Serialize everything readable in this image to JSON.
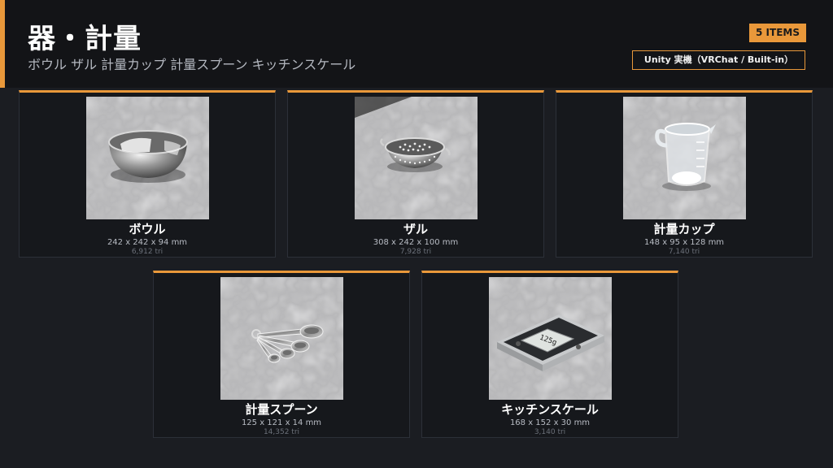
{
  "header": {
    "title": "器・計量",
    "subtitle": "ボウル ザル 計量カップ 計量スプーン キッチンスケール",
    "count_badge": "5 ITEMS",
    "env_badge": "Unity 実機（VRChat / Built-in）"
  },
  "colors": {
    "accent": "#e9983a",
    "background": "#1b1d22",
    "card_background": "#16181c"
  },
  "items": [
    {
      "name": "ボウル",
      "dims": "242 x 242 x 94 mm",
      "tris": "6,912 tri",
      "icon": "bowl-icon"
    },
    {
      "name": "ザル",
      "dims": "308 x 242 x 100 mm",
      "tris": "7,928 tri",
      "icon": "colander-icon"
    },
    {
      "name": "計量カップ",
      "dims": "148 x 95 x 128 mm",
      "tris": "7,140 tri",
      "icon": "measuring-cup-icon"
    },
    {
      "name": "計量スプーン",
      "dims": "125 x 121 x 14 mm",
      "tris": "14,352 tri",
      "icon": "measuring-spoons-icon"
    },
    {
      "name": "キッチンスケール",
      "dims": "168 x 152 x 30 mm",
      "tris": "3,140 tri",
      "icon": "kitchen-scale-icon",
      "display": "125g"
    }
  ]
}
